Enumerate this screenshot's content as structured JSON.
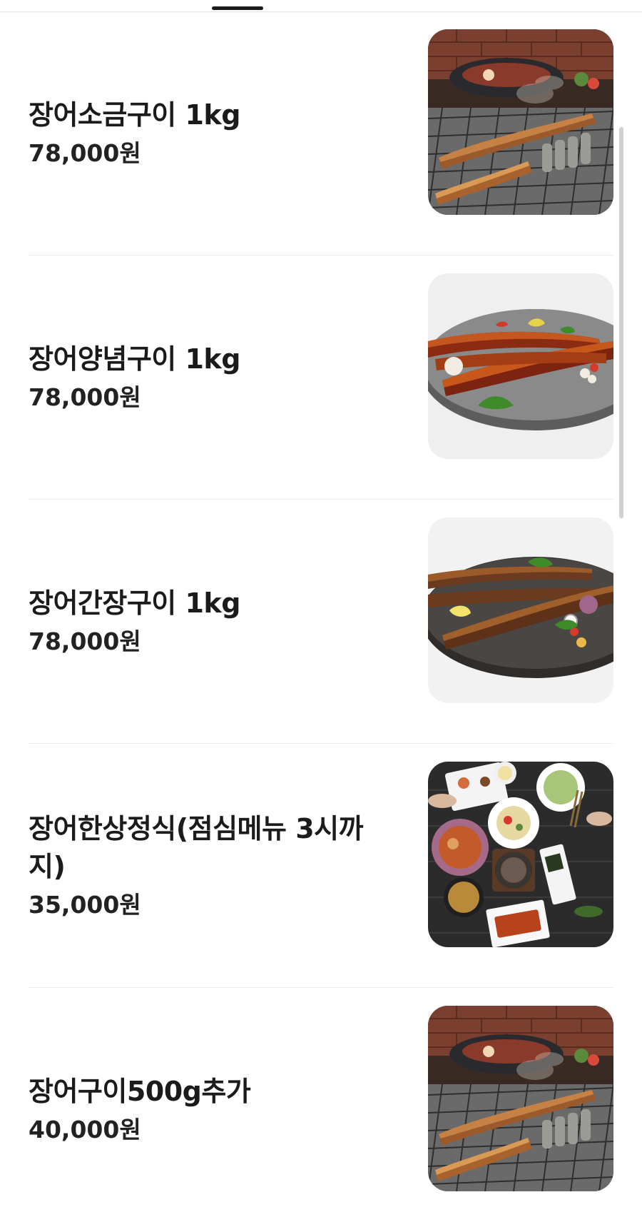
{
  "menu": {
    "items": [
      {
        "name": "장어소금구이 1kg",
        "price": "78,000원",
        "image": "grilled-eel-on-grill-photo"
      },
      {
        "name": "장어양념구이 1kg",
        "price": "78,000원",
        "image": "seasoned-eel-plate-photo"
      },
      {
        "name": "장어간장구이 1kg",
        "price": "78,000원",
        "image": "soy-glazed-eel-plate-photo"
      },
      {
        "name": "장어한상정식(점심메뉴 3시까지)",
        "price": "35,000원",
        "image": "eel-set-meal-table-photo"
      },
      {
        "name": "장어구이500g추가",
        "price": "40,000원",
        "image": "grilled-eel-on-grill-photo"
      }
    ]
  },
  "colors": {
    "text": "#1b1b1b",
    "divider": "#ececec",
    "tab_indicator": "#1a1a1a",
    "scrollbar": "#d0d0d0"
  }
}
